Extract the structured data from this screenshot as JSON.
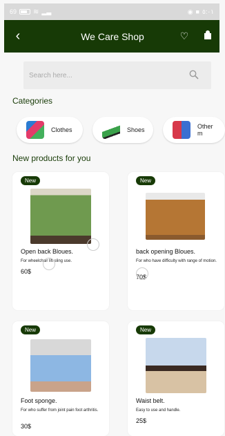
{
  "status_bar": {
    "left": "69",
    "right": "٥:٠١"
  },
  "app_bar": {
    "title": "We Care Shop",
    "back_icon": "arrow-left",
    "favorite_icon": "heart",
    "bag_icon": "shopping-bag"
  },
  "search": {
    "placeholder": "Search here...",
    "icon": "search"
  },
  "categories": {
    "title": "Categories",
    "items": [
      {
        "label": "Clothes"
      },
      {
        "label": "Shoes"
      },
      {
        "label": "Other m"
      }
    ]
  },
  "products": {
    "title": "New products for you",
    "items": [
      {
        "badge": "New",
        "name": "Open back Bloues.",
        "desc": "For wheelchair lift sling use.",
        "price": "60$"
      },
      {
        "badge": "New",
        "name": "back opening Bloues.",
        "desc": "For who have difficulty with range of motion.",
        "price": "70$"
      },
      {
        "badge": "New",
        "name": "Foot sponge.",
        "desc": "For who suffer from joint pain foot arthritis.",
        "price": "30$"
      },
      {
        "badge": "New",
        "name": "Waist belt.",
        "desc": "Easy to use and handle.",
        "price": "25$"
      }
    ]
  },
  "colors": {
    "primary": "#173a06",
    "background": "#f7f7f7",
    "card": "#ffffff"
  }
}
